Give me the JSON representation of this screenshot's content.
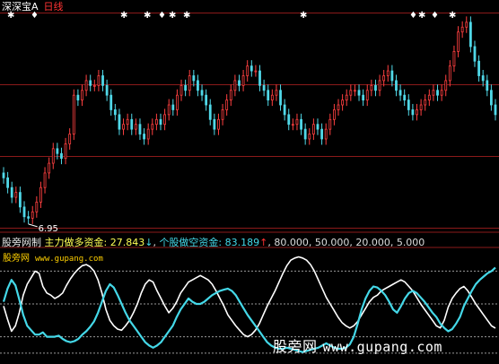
{
  "header": {
    "stock_name": "深深宝A",
    "period": "日线"
  },
  "indicator_bar": {
    "prefix": "股旁网制",
    "main_label": "主力做多资金:",
    "main_value": "27.843",
    "main_arrow": "↓",
    "sep": ",",
    "sub_label": "个股做空资金:",
    "sub_value": "83.189",
    "sub_arrow": "↑",
    "levels_text": ", 80.000, 50.000, 20.000, 5.000"
  },
  "site_label": {
    "name": "股旁网",
    "url": "www.gupang.com"
  },
  "watermark": {
    "name": "股旁网",
    "url": "www.gupang.com"
  },
  "colors": {
    "up": "#ff4040",
    "down": "#50d8e8",
    "bull_line": "#ffffff",
    "bear_line": "#44d8e8",
    "grid": "#8b1a1a",
    "level": "#9a9a9a"
  },
  "chart_data": [
    {
      "type": "candlestick",
      "title": "深深宝A 日线",
      "low_marker": "6.95",
      "signal_glyphs": [
        "✱",
        "♦",
        "✱",
        "✱",
        "♦",
        "✱",
        "✱",
        "✱",
        "♦",
        "✱",
        "♦",
        "✱"
      ],
      "grid": true,
      "ylim": [
        6.7,
        11.2
      ],
      "closes": [
        7.8,
        7.6,
        7.4,
        7.5,
        7.2,
        7.0,
        6.97,
        7.1,
        7.3,
        7.6,
        7.9,
        8.1,
        8.4,
        8.3,
        8.2,
        8.5,
        8.7,
        9.5,
        9.4,
        9.6,
        9.8,
        9.7,
        9.7,
        9.9,
        9.7,
        9.5,
        9.2,
        9.1,
        8.8,
        8.9,
        9.0,
        8.8,
        8.9,
        8.7,
        8.6,
        8.8,
        8.9,
        9.0,
        8.9,
        9.1,
        9.3,
        9.2,
        9.5,
        9.7,
        9.6,
        9.9,
        9.8,
        9.6,
        9.5,
        9.3,
        9.0,
        8.8,
        9.0,
        9.2,
        9.4,
        9.6,
        9.8,
        9.7,
        9.9,
        10.1,
        10.0,
        10.0,
        9.7,
        9.6,
        9.4,
        9.5,
        9.6,
        9.3,
        9.1,
        8.9,
        8.9,
        9.0,
        8.8,
        8.6,
        8.7,
        8.9,
        8.8,
        8.6,
        8.8,
        9.0,
        9.2,
        9.3,
        9.4,
        9.5,
        9.6,
        9.6,
        9.5,
        9.4,
        9.6,
        9.7,
        9.6,
        9.8,
        9.9,
        10.0,
        9.8,
        9.6,
        9.5,
        9.4,
        9.2,
        9.1,
        9.2,
        9.3,
        9.4,
        9.5,
        9.6,
        9.5,
        9.6,
        9.8,
        10.1,
        10.4,
        10.8,
        10.9,
        11.0,
        10.5,
        10.2,
        9.9,
        9.8,
        9.6,
        9.3,
        9.1
      ],
      "ylabel": ""
    },
    {
      "type": "line",
      "series": [
        {
          "name": "主力做多资金",
          "values": [
            48,
            36,
            25,
            30,
            42,
            58,
            68,
            74,
            80,
            78,
            66,
            60,
            58,
            55,
            57,
            60,
            67,
            73,
            78,
            82,
            85,
            86,
            84,
            80,
            72,
            60,
            45,
            35,
            30,
            27,
            26,
            30,
            35,
            42,
            50,
            60,
            68,
            72,
            70,
            62,
            55,
            48,
            42,
            46,
            52,
            60,
            65,
            70,
            72,
            74,
            76,
            74,
            72,
            68,
            62,
            55,
            48,
            40,
            35,
            30,
            26,
            22,
            20,
            22,
            26,
            32,
            40,
            48,
            55,
            62,
            70,
            78,
            85,
            90,
            92,
            93,
            92,
            90,
            86,
            80,
            72,
            64,
            56,
            50,
            44,
            38,
            33,
            30,
            28,
            30,
            34,
            40,
            46,
            52,
            56,
            58,
            62,
            64,
            66,
            68,
            70,
            72,
            70,
            66,
            62,
            56,
            50,
            45,
            40,
            35,
            30,
            28,
            35,
            47,
            55,
            60,
            64,
            66,
            62,
            56,
            50,
            45,
            40,
            35,
            30,
            27.843
          ]
        },
        {
          "name": "个股做空资金",
          "values": [
            52,
            64,
            72,
            67,
            54,
            40,
            30,
            26,
            22,
            22,
            24,
            20,
            20,
            20,
            21,
            18,
            16,
            15,
            16,
            18,
            22,
            25,
            29,
            34,
            42,
            52,
            62,
            68,
            65,
            58,
            50,
            42,
            35,
            30,
            25,
            20,
            15,
            12,
            10,
            12,
            15,
            20,
            25,
            30,
            38,
            45,
            50,
            55,
            52,
            50,
            50,
            52,
            55,
            58,
            60,
            62,
            63,
            64,
            62,
            58,
            52,
            46,
            40,
            35,
            30,
            25,
            20,
            15,
            12,
            10,
            9,
            9,
            10,
            9,
            8,
            7,
            6,
            7,
            8,
            9,
            10,
            12,
            14,
            12,
            10,
            9,
            9,
            10,
            13,
            20,
            32,
            45,
            55,
            62,
            66,
            65,
            62,
            58,
            52,
            45,
            42,
            48,
            55,
            60,
            62,
            60,
            56,
            52,
            47,
            42,
            38,
            32,
            28,
            25,
            27,
            32,
            38,
            48,
            55,
            62,
            68,
            72,
            75,
            78,
            80,
            83.189
          ]
        }
      ],
      "levels": [
        80,
        50,
        20,
        5
      ],
      "ylim": [
        0,
        100
      ],
      "xlabel": "",
      "ylabel": ""
    }
  ]
}
